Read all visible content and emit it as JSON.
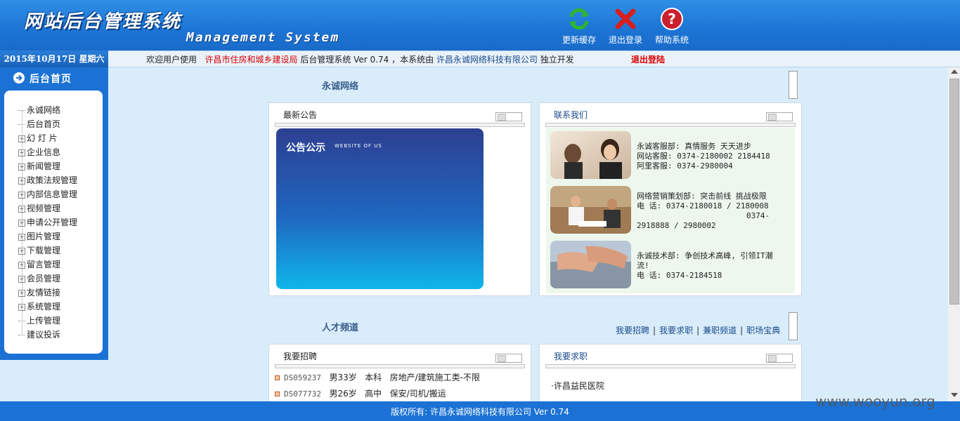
{
  "header": {
    "title_cn": "网站后台管理系统",
    "title_en": "Management System",
    "buttons": [
      {
        "label": "更新缓存",
        "icon": "refresh-icon"
      },
      {
        "label": "退出登录",
        "icon": "close-icon"
      },
      {
        "label": "帮助系统",
        "icon": "help-icon"
      }
    ]
  },
  "statusbar": {
    "date": "2015年10月17日 星期六",
    "welcome_prefix": "欢迎用户使用",
    "org": "许昌市住房和城乡建设局",
    "system_text": "后台管理系统 Ver 0.74 ，本系统由",
    "company": "许昌永诚网络科技有限公司",
    "suffix": "独立开发",
    "logout": "退出登陆"
  },
  "sidebar": {
    "home_label": "后台首页",
    "items": [
      {
        "label": "永诚网络",
        "expandable": false
      },
      {
        "label": "后台首页",
        "expandable": false
      },
      {
        "label": "幻 灯 片",
        "expandable": true
      },
      {
        "label": "企业信息",
        "expandable": true
      },
      {
        "label": "新闻管理",
        "expandable": true
      },
      {
        "label": "政策法规管理",
        "expandable": true
      },
      {
        "label": "内部信息管理",
        "expandable": true
      },
      {
        "label": "视频管理",
        "expandable": true
      },
      {
        "label": "申请公开管理",
        "expandable": true
      },
      {
        "label": "图片管理",
        "expandable": true
      },
      {
        "label": "下载管理",
        "expandable": true
      },
      {
        "label": "留言管理",
        "expandable": true
      },
      {
        "label": "会员管理",
        "expandable": true
      },
      {
        "label": "友情链接",
        "expandable": true
      },
      {
        "label": "系统管理",
        "expandable": true
      },
      {
        "label": "上传管理",
        "expandable": false
      },
      {
        "label": "建议投诉",
        "expandable": false
      }
    ]
  },
  "main": {
    "section1_title": "永诚网络",
    "notice_panel": {
      "title": "最新公告",
      "card_title": "公告公示",
      "card_sub": "WEBSITE OF US"
    },
    "contact_panel": {
      "title": "联系我们",
      "entries": [
        {
          "lines": [
            "永诚客服部: 真情服务 天天进步",
            "网站客服: 0374-2180002 2184418",
            "阿里客服: 0374-2980004"
          ]
        },
        {
          "lines": [
            "网络营销策划部: 突击前线 挑战极限",
            "电 话: 0374-2180018 / 2180008",
            "0374-",
            "2918888 / 2980002"
          ]
        },
        {
          "lines": [
            "永诚技术部: 争创技术高峰, 引领IT潮",
            "流!",
            "电 话: 0374-2184518"
          ]
        }
      ]
    },
    "section2_title": "人才频道",
    "talent_links": [
      "我要招聘",
      "我要求职",
      "兼职频道",
      "职场宝典"
    ],
    "recruit_panel": {
      "title": "我要招聘",
      "rows": [
        {
          "code": "DS059237",
          "age": "男33岁",
          "edu": "本科",
          "job": "房地产/建筑施工类-不限"
        },
        {
          "code": "DS077732",
          "age": "男26岁",
          "edu": "高中",
          "job": "保安/司机/搬运"
        }
      ]
    },
    "jobseek_panel": {
      "title": "我要求职",
      "items": [
        "·许昌益民医院"
      ]
    }
  },
  "footer": {
    "text": "版权所有: 许昌永诚网络科技有限公司 Ver 0.74",
    "watermark": "www.wooyun.org"
  },
  "colors": {
    "header_blue": "#1c74d4",
    "accent_red": "#d40000",
    "link_blue": "#1a4a8a"
  }
}
